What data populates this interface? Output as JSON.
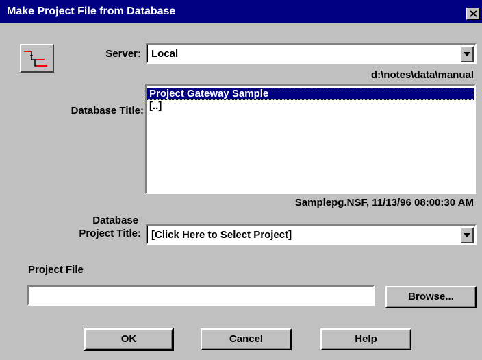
{
  "window": {
    "title": "Make Project File from Database",
    "close_glyph": "✕"
  },
  "icon": {
    "name": "project-database-icon",
    "color": "#ff0000"
  },
  "server": {
    "label": "Server:",
    "value": "Local",
    "path": "d:\\notes\\data\\manual"
  },
  "database": {
    "label": "Database Title:",
    "items": [
      {
        "label": "Project Gateway Sample",
        "selected": true
      },
      {
        "label": "[..]",
        "selected": false
      }
    ],
    "info": "Samplepg.NSF, 11/13/96 08:00:30 AM"
  },
  "project_title": {
    "label_line1": "Database",
    "label_line2": "Project Title:",
    "value": "[Click Here to Select Project]"
  },
  "project_file": {
    "label": "Project File",
    "value": "",
    "browse_label": "Browse..."
  },
  "buttons": {
    "ok": "OK",
    "cancel": "Cancel",
    "help": "Help"
  },
  "colors": {
    "titlebar": "#000080",
    "face": "#c0c0c0",
    "selection": "#000080"
  }
}
